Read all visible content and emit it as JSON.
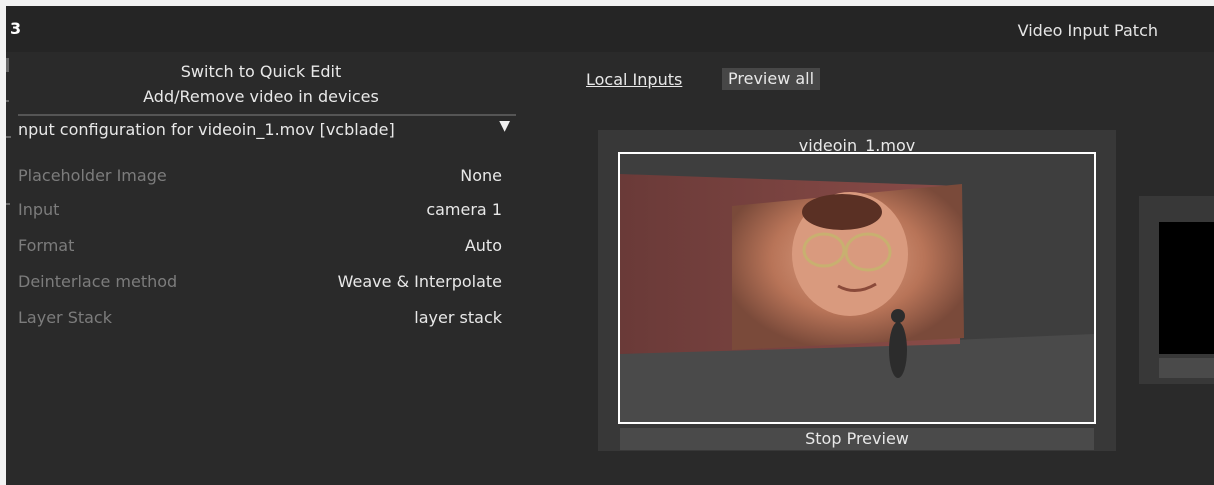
{
  "app": {
    "logo_glyph": "3",
    "title": "Video Input Patch"
  },
  "left_panel": {
    "switch_label": "Switch to Quick Edit",
    "addremove_label": "Add/Remove video in devices",
    "section_header": "nput configuration for videoin_1.mov [vcblade]",
    "section_arrow": "▼",
    "properties": [
      {
        "label": "Placeholder Image",
        "value": "None"
      },
      {
        "label": "Input",
        "value": "camera 1"
      },
      {
        "label": "Format",
        "value": "Auto"
      },
      {
        "label": "Deinterlace method",
        "value": "Weave & Interpolate"
      },
      {
        "label": "Layer Stack",
        "value": "layer stack"
      }
    ]
  },
  "tabs": {
    "local_inputs": "Local Inputs",
    "preview_all": "Preview all"
  },
  "preview_card": {
    "title": "videoin_1.mov",
    "stop_label": "Stop Preview"
  }
}
